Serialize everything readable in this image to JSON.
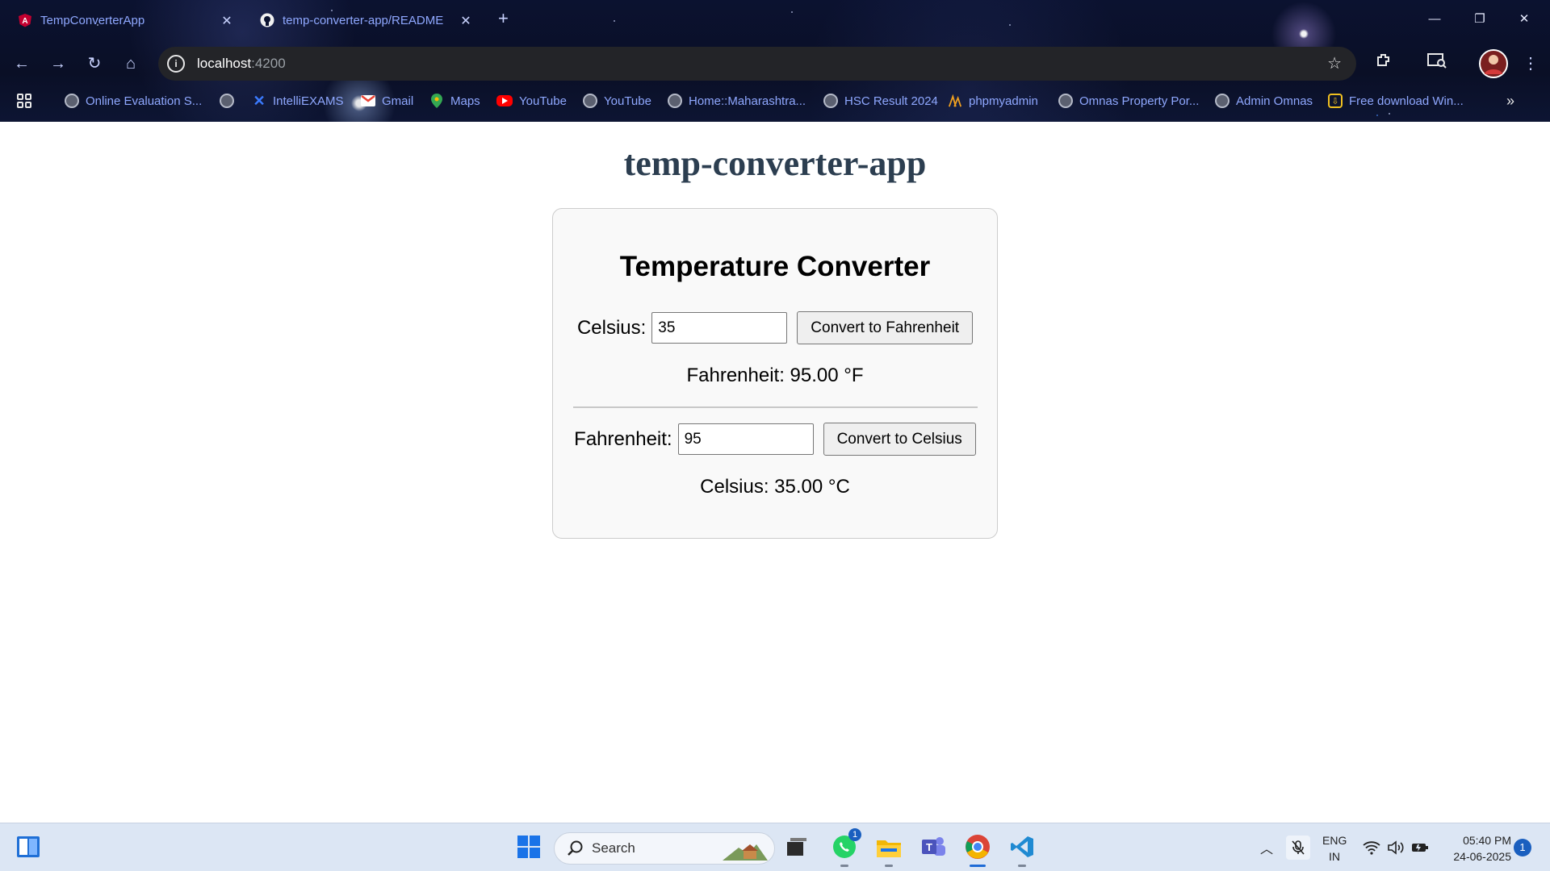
{
  "browser": {
    "tabs": [
      {
        "title": "TempConverterApp",
        "icon": "angular-icon"
      },
      {
        "title": "temp-converter-app/README",
        "icon": "github-icon"
      }
    ],
    "address": {
      "host": "localhost",
      "port": ":4200"
    },
    "bookmarks": [
      {
        "label": "Online Evaluation S...",
        "icon": "globe-icon"
      },
      {
        "label": "",
        "icon": "globe-icon"
      },
      {
        "label": "IntelliEXAMS",
        "icon": "x-logo-icon"
      },
      {
        "label": "Gmail",
        "icon": "gmail-icon"
      },
      {
        "label": "Maps",
        "icon": "maps-pin-icon"
      },
      {
        "label": "YouTube",
        "icon": "youtube-icon"
      },
      {
        "label": "YouTube",
        "icon": "globe-icon"
      },
      {
        "label": "Home::Maharashtra...",
        "icon": "globe-icon"
      },
      {
        "label": "HSC Result 2024",
        "icon": "globe-icon"
      },
      {
        "label": "phpmyadmin",
        "icon": "phpmyadmin-icon"
      },
      {
        "label": "Omnas Property Por...",
        "icon": "globe-icon"
      },
      {
        "label": "Admin Omnas",
        "icon": "globe-icon"
      },
      {
        "label": "Free download Win...",
        "icon": "download-site-icon"
      }
    ]
  },
  "app": {
    "title": "temp-converter-app",
    "card_title": "Temperature Converter",
    "celsius": {
      "label": "Celsius:",
      "value": "35",
      "button": "Convert to Fahrenheit",
      "result": "Fahrenheit: 95.00 °F"
    },
    "fahrenheit": {
      "label": "Fahrenheit:",
      "value": "95",
      "button": "Convert to Celsius",
      "result": "Celsius: 35.00 °C"
    }
  },
  "taskbar": {
    "search_label": "Search",
    "whatsapp_badge": "1",
    "lang_line1": "ENG",
    "lang_line2": "IN",
    "time": "05:40 PM",
    "date": "24-06-2025",
    "notification_count": "1"
  },
  "colors": {
    "title_text": "#2c3e50",
    "card_bg": "#f9f9f9",
    "tab_text": "#8fa8ff",
    "taskbar_bg": "#dce6f4"
  }
}
